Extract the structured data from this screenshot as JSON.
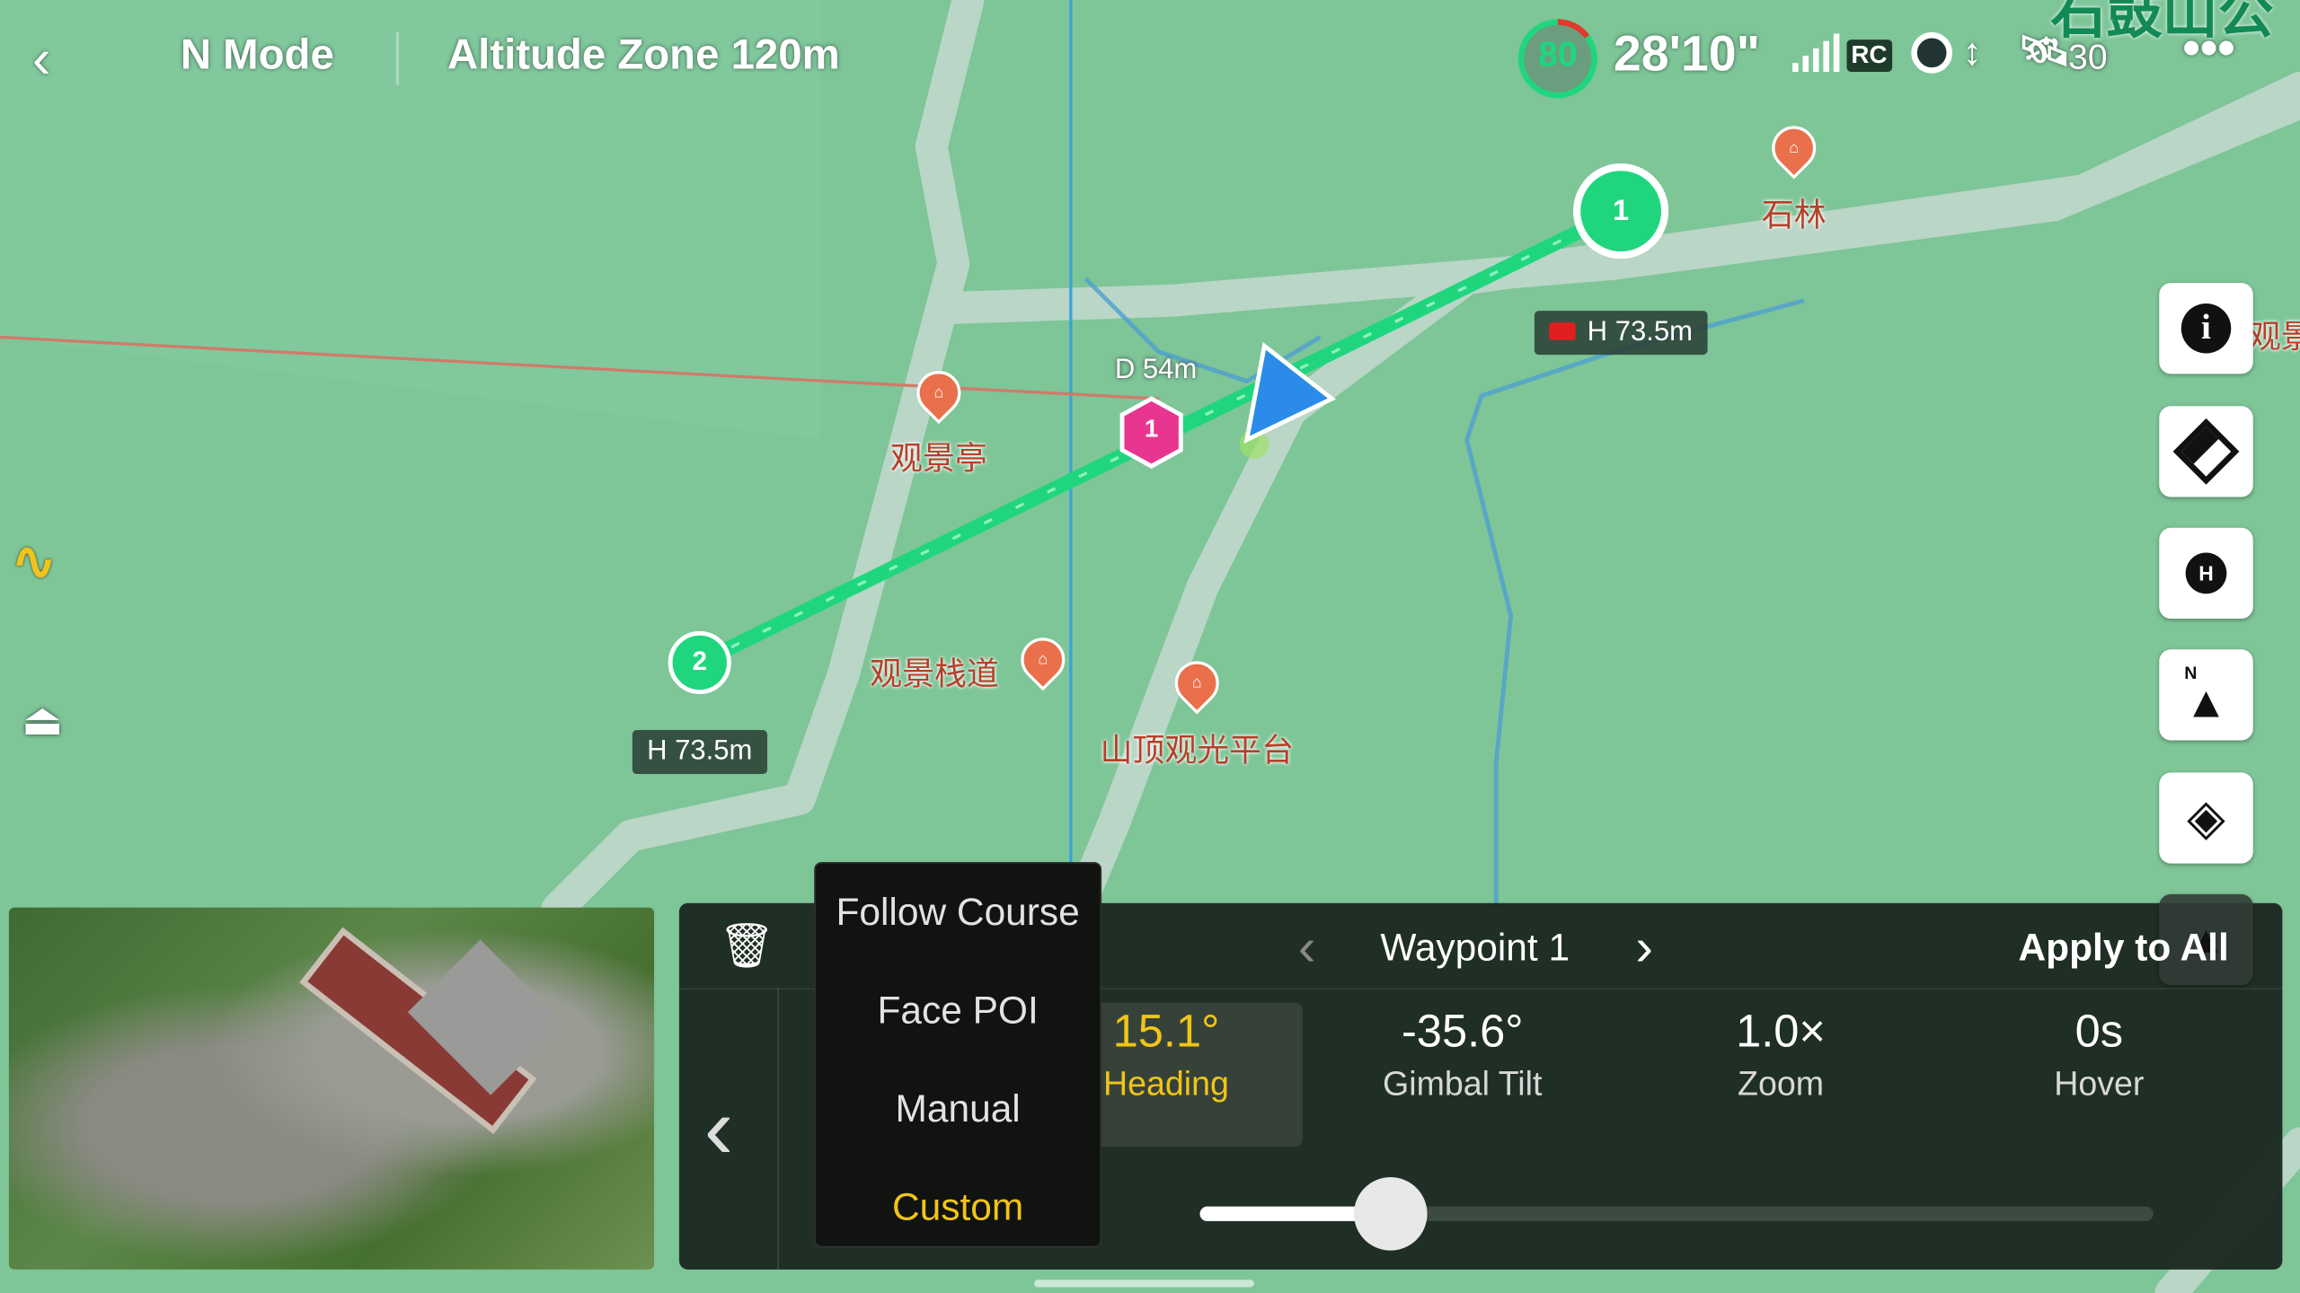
{
  "top_bar": {
    "back_icon": "chevron-left-icon",
    "mode": "N Mode",
    "altitude_zone": "Altitude Zone 120m",
    "battery_percent": "80",
    "flight_time": "28'10\"",
    "rc_label": "RC",
    "satellite_count": "30",
    "more_icon": "more-dots-icon"
  },
  "map": {
    "labels": {
      "pavilion": "观景亭",
      "plank_road": "观景栈道",
      "summit_platform": "山顶观光平台",
      "stone_forest": "石林",
      "viewpoint_partial": "观景",
      "park_partial": "石鼓山公"
    },
    "waypoints": [
      {
        "number": "1",
        "height": "H 73.5m"
      },
      {
        "number": "2",
        "height": "H 73.5m"
      }
    ],
    "poi": {
      "number": "1",
      "distance": "D 54m"
    },
    "colors": {
      "route": "#1fd67e",
      "poi": "#e8358f",
      "aircraft": "#2a8ce8",
      "map": "#7ec598"
    }
  },
  "right_tools": [
    "info-icon",
    "eraser-icon",
    "home-point-icon",
    "north-compass-icon",
    "layers-icon",
    "more-tool-icon"
  ],
  "left_tools": [
    "route-icon",
    "takeoff-icon"
  ],
  "panel": {
    "title": "Waypoint 1",
    "apply_all": "Apply to All",
    "params": [
      {
        "value": "15.1°",
        "label": "Heading",
        "selected": true
      },
      {
        "value": "-35.6°",
        "label": "Gimbal Tilt"
      },
      {
        "value": "1.0×",
        "label": "Zoom"
      },
      {
        "value": "0s",
        "label": "Hover"
      }
    ],
    "slider_percent": 20,
    "accent_color": "#f0c419"
  },
  "dropdown": {
    "options": [
      "Follow Course",
      "Face POI",
      "Manual",
      "Custom"
    ],
    "selected": "Custom"
  }
}
